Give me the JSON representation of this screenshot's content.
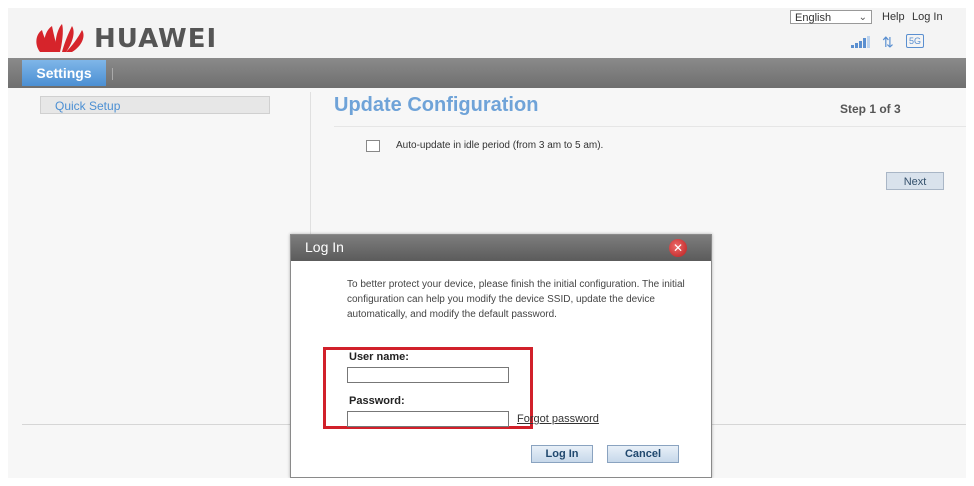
{
  "header": {
    "logo_text": "HUAWEI",
    "language_selected": "English",
    "help_label": "Help",
    "login_label": "Log In",
    "network_badge": "5G"
  },
  "navbar": {
    "tab_label": "Settings"
  },
  "sidebar": {
    "items": [
      {
        "label": "Quick Setup"
      }
    ]
  },
  "main": {
    "title": "Update Configuration",
    "step_label": "Step 1 of 3",
    "checkbox_label": "Auto-update in idle period (from 3 am to 5 am).",
    "checkbox_checked": false,
    "next_label": "Next"
  },
  "dialog": {
    "title": "Log In",
    "message": "To better protect your device, please finish the initial configuration. The initial configuration can help you modify the device SSID, update the device automatically, and modify the default password.",
    "username_label": "User name:",
    "username_value": "",
    "password_label": "Password:",
    "password_value": "",
    "forgot_label": "Forgot password",
    "login_button": "Log In",
    "cancel_button": "Cancel"
  },
  "colors": {
    "accent_blue": "#4b8fd3",
    "title_blue": "#6fa3d8",
    "highlight_red": "#d1202a",
    "logo_red": "#d6242b"
  },
  "icons": {
    "signal": "signal-bars-icon",
    "transfer": "up-down-arrows-icon",
    "close": "close-icon",
    "dropdown": "chevron-down-icon"
  }
}
